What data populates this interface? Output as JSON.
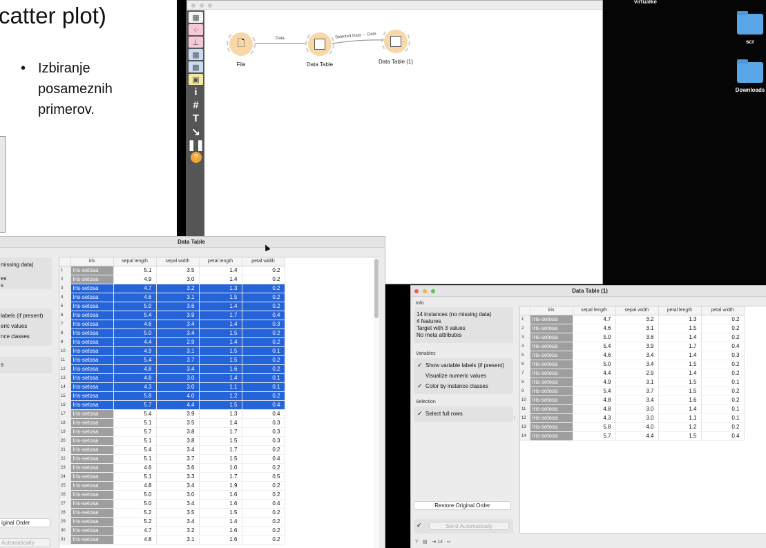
{
  "slide": {
    "title": "catter plot)",
    "bullet": "•",
    "bullet_text": "Izbiranje\nposameznih\nprimerov."
  },
  "desktop": {
    "user": "virtualke",
    "folders": [
      "scr",
      "Downloads"
    ]
  },
  "canvas": {
    "widgets": [
      "File",
      "Data Table",
      "Data Table (1)"
    ],
    "links": [
      "Data",
      "Selected Data → Data"
    ],
    "toolbox_icons": [
      "table-icon",
      "scatter-icon",
      "tree-icon",
      "grid-icon",
      "heatmap-icon",
      "image-icon",
      "info-icon",
      "hash-icon",
      "text-icon",
      "arrow-icon",
      "pause-icon",
      "help-icon"
    ],
    "toolbox_glyphs": [
      "▦",
      "⁘",
      "⊥",
      "▦",
      "▩",
      "▣",
      "i",
      "#",
      "T",
      "↘",
      "❚❚",
      "?"
    ]
  },
  "window1": {
    "title": "Data Table",
    "info_fragments": [
      "missing data)",
      "es",
      "s"
    ],
    "variables_fragments": [
      "labels (if present)",
      "eric values",
      "nce classes"
    ],
    "selection_fragment": "s",
    "restore_fragment": "iginal Order",
    "send_fragment": "Automatically",
    "columns": [
      "iris",
      "sepal length",
      "sepal width",
      "petal length",
      "petal width"
    ],
    "rows": [
      [
        "1",
        "Iris-setosa",
        "5.1",
        "3.5",
        "1.4",
        "0.2"
      ],
      [
        "2",
        "Iris-setosa",
        "4.9",
        "3.0",
        "1.4",
        "0.2"
      ],
      [
        "3",
        "Iris-setosa",
        "4.7",
        "3.2",
        "1.3",
        "0.2"
      ],
      [
        "4",
        "Iris-setosa",
        "4.6",
        "3.1",
        "1.5",
        "0.2"
      ],
      [
        "5",
        "Iris-setosa",
        "5.0",
        "3.6",
        "1.4",
        "0.2"
      ],
      [
        "6",
        "Iris-setosa",
        "5.4",
        "3.9",
        "1.7",
        "0.4"
      ],
      [
        "7",
        "Iris-setosa",
        "4.6",
        "3.4",
        "1.4",
        "0.3"
      ],
      [
        "8",
        "Iris-setosa",
        "5.0",
        "3.4",
        "1.5",
        "0.2"
      ],
      [
        "9",
        "Iris-setosa",
        "4.4",
        "2.9",
        "1.4",
        "0.2"
      ],
      [
        "10",
        "Iris-setosa",
        "4.9",
        "3.1",
        "1.5",
        "0.1"
      ],
      [
        "11",
        "Iris-setosa",
        "5.4",
        "3.7",
        "1.5",
        "0.2"
      ],
      [
        "12",
        "Iris-setosa",
        "4.8",
        "3.4",
        "1.6",
        "0.2"
      ],
      [
        "13",
        "Iris-setosa",
        "4.8",
        "3.0",
        "1.4",
        "0.1"
      ],
      [
        "14",
        "Iris-setosa",
        "4.3",
        "3.0",
        "1.1",
        "0.1"
      ],
      [
        "15",
        "Iris-setosa",
        "5.8",
        "4.0",
        "1.2",
        "0.2"
      ],
      [
        "16",
        "Iris-setosa",
        "5.7",
        "4.4",
        "1.5",
        "0.4"
      ],
      [
        "17",
        "Iris-setosa",
        "5.4",
        "3.9",
        "1.3",
        "0.4"
      ],
      [
        "18",
        "Iris-setosa",
        "5.1",
        "3.5",
        "1.4",
        "0.3"
      ],
      [
        "19",
        "Iris-setosa",
        "5.7",
        "3.8",
        "1.7",
        "0.3"
      ],
      [
        "20",
        "Iris-setosa",
        "5.1",
        "3.8",
        "1.5",
        "0.3"
      ],
      [
        "21",
        "Iris-setosa",
        "5.4",
        "3.4",
        "1.7",
        "0.2"
      ],
      [
        "22",
        "Iris-setosa",
        "5.1",
        "3.7",
        "1.5",
        "0.4"
      ],
      [
        "23",
        "Iris-setosa",
        "4.6",
        "3.6",
        "1.0",
        "0.2"
      ],
      [
        "24",
        "Iris-setosa",
        "5.1",
        "3.3",
        "1.7",
        "0.5"
      ],
      [
        "25",
        "Iris-setosa",
        "4.8",
        "3.4",
        "1.9",
        "0.2"
      ],
      [
        "26",
        "Iris-setosa",
        "5.0",
        "3.0",
        "1.6",
        "0.2"
      ],
      [
        "27",
        "Iris-setosa",
        "5.0",
        "3.4",
        "1.6",
        "0.4"
      ],
      [
        "28",
        "Iris-setosa",
        "5.2",
        "3.5",
        "1.5",
        "0.2"
      ],
      [
        "29",
        "Iris-setosa",
        "5.2",
        "3.4",
        "1.4",
        "0.2"
      ],
      [
        "30",
        "Iris-setosa",
        "4.7",
        "3.2",
        "1.6",
        "0.2"
      ],
      [
        "31",
        "Iris-setosa",
        "4.8",
        "3.1",
        "1.6",
        "0.2"
      ]
    ],
    "selected_rows": [
      3,
      4,
      5,
      6,
      7,
      8,
      9,
      10,
      11,
      12,
      13,
      14,
      15,
      16
    ]
  },
  "window2": {
    "title": "Data Table (1)",
    "info_title": "Info",
    "info_lines": [
      "14 instances (no missing data)",
      "4 features",
      "Target with 3 values",
      "No meta attributes"
    ],
    "variables_title": "Variables",
    "variables": [
      {
        "label": "Show variable labels (if present)",
        "checked": true
      },
      {
        "label": "Visualize numeric values",
        "checked": false
      },
      {
        "label": "Color by instance classes",
        "checked": true
      }
    ],
    "selection_title": "Selection",
    "selection": {
      "label": "Select full rows",
      "checked": true
    },
    "restore_label": "Restore Original Order",
    "send_label": "Send Automatically",
    "status_count": "14",
    "columns": [
      "iris",
      "sepal length",
      "sepal width",
      "petal length",
      "petal width"
    ],
    "rows": [
      [
        "1",
        "Iris-setosa",
        "4.7",
        "3.2",
        "1.3",
        "0.2"
      ],
      [
        "2",
        "Iris-setosa",
        "4.6",
        "3.1",
        "1.5",
        "0.2"
      ],
      [
        "3",
        "Iris-setosa",
        "5.0",
        "3.6",
        "1.4",
        "0.2"
      ],
      [
        "4",
        "Iris-setosa",
        "5.4",
        "3.9",
        "1.7",
        "0.4"
      ],
      [
        "5",
        "Iris-setosa",
        "4.6",
        "3.4",
        "1.4",
        "0.3"
      ],
      [
        "6",
        "Iris-setosa",
        "5.0",
        "3.4",
        "1.5",
        "0.2"
      ],
      [
        "7",
        "Iris-setosa",
        "4.4",
        "2.9",
        "1.4",
        "0.2"
      ],
      [
        "8",
        "Iris-setosa",
        "4.9",
        "3.1",
        "1.5",
        "0.1"
      ],
      [
        "9",
        "Iris-setosa",
        "5.4",
        "3.7",
        "1.5",
        "0.2"
      ],
      [
        "10",
        "Iris-setosa",
        "4.8",
        "3.4",
        "1.6",
        "0.2"
      ],
      [
        "11",
        "Iris-setosa",
        "4.8",
        "3.0",
        "1.4",
        "0.1"
      ],
      [
        "12",
        "Iris-setosa",
        "4.3",
        "3.0",
        "1.1",
        "0.1"
      ],
      [
        "13",
        "Iris-setosa",
        "5.8",
        "4.0",
        "1.2",
        "0.2"
      ],
      [
        "14",
        "Iris-setosa",
        "5.7",
        "4.4",
        "1.5",
        "0.4"
      ]
    ]
  }
}
